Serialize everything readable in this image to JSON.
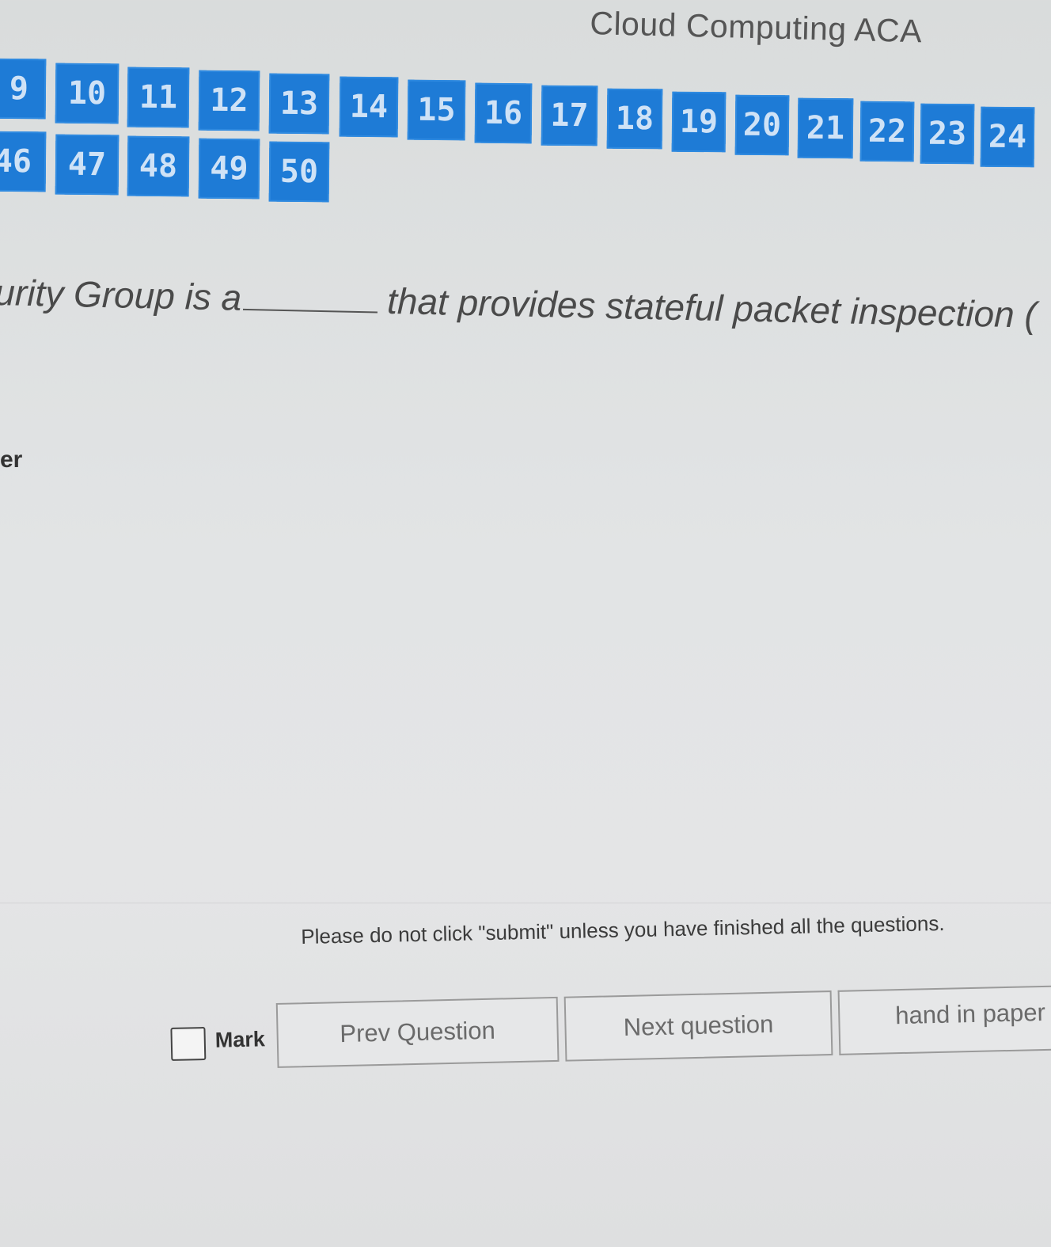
{
  "header": {
    "title": "Cloud Computing ACA"
  },
  "question_nav": {
    "row1": [
      "9",
      "10",
      "11",
      "12",
      "13",
      "14",
      "15",
      "16",
      "17",
      "18",
      "19",
      "20",
      "21",
      "22",
      "23",
      "24"
    ],
    "row2": [
      "46",
      "47",
      "48",
      "49",
      "50"
    ]
  },
  "question": {
    "text_before": "urity Group is a",
    "text_after": "that provides stateful packet inspection (",
    "answer_label": "er"
  },
  "footer": {
    "warning": "Please do not click \"submit\" unless you have finished all the questions.",
    "mark_label": "Mark",
    "prev_label": "Prev Question",
    "next_label": "Next question",
    "hand_in_label": "hand in paper"
  },
  "colors": {
    "nav_button": "#1e7bd6",
    "nav_text": "#cfe2f6",
    "background": "#e2e4e5"
  }
}
